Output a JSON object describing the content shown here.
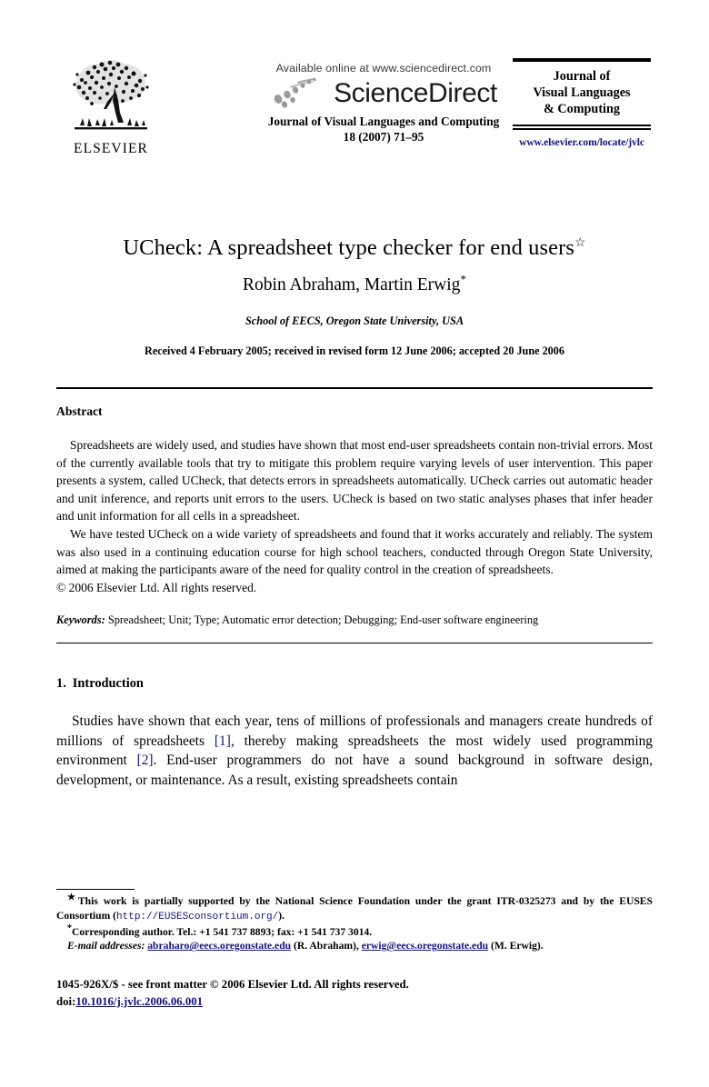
{
  "masthead": {
    "publisher_logo_name": "elsevier-tree-logo",
    "publisher_wordmark": "ELSEVIER",
    "available_online": "Available online at www.sciencedirect.com",
    "sciencedirect_wordmark": "ScienceDirect",
    "journal_name_line": "Journal of Visual Languages and Computing",
    "volume_line": "18 (2007) 71–95",
    "journal_box_title_line1": "Journal of",
    "journal_box_title_line2": "Visual Languages",
    "journal_box_title_line3": "& Computing",
    "journal_url": "www.elsevier.com/locate/jvlc",
    "link_color": "#14137a"
  },
  "title_block": {
    "title": "UCheck: A spreadsheet type checker for end users",
    "title_footnote_marker": "☆",
    "authors": "Robin Abraham, Martin Erwig",
    "author_footnote_marker": "*",
    "affiliation": "School of EECS, Oregon State University, USA",
    "received": "Received 4 February 2005; received in revised form 12 June 2006; accepted 20 June 2006"
  },
  "abstract": {
    "heading": "Abstract",
    "paragraph_1": "Spreadsheets are widely used, and studies have shown that most end-user spreadsheets contain non-trivial errors. Most of the currently available tools that try to mitigate this problem require varying levels of user intervention. This paper presents a system, called UCheck, that detects errors in spreadsheets automatically. UCheck carries out automatic header and unit inference, and reports unit errors to the users. UCheck is based on two static analyses phases that infer header and unit information for all cells in a spreadsheet.",
    "paragraph_2": "We have tested UCheck on a wide variety of spreadsheets and found that it works accurately and reliably. The system was also used in a continuing education course for high school teachers, conducted through Oregon State University, aimed at making the participants aware of the need for quality control in the creation of spreadsheets.",
    "copyright": "© 2006 Elsevier Ltd. All rights reserved.",
    "keywords_label": "Keywords:",
    "keywords_value": "Spreadsheet; Unit; Type; Automatic error detection; Debugging; End-user software engineering"
  },
  "introduction": {
    "section_number": "1.",
    "section_title": "Introduction",
    "paragraph_part_1": "Studies have shown that each year, tens of millions of professionals and managers create hundreds of millions of spreadsheets ",
    "citation_1": "[1]",
    "paragraph_part_2": ", thereby making spreadsheets the most widely used programming environment ",
    "citation_2": "[2]",
    "paragraph_part_3": ". End-user programmers do not have a sound background in software design, development, or maintenance. As a result, existing spreadsheets contain"
  },
  "footnotes": {
    "star_marker": "★",
    "funding_part_1": "This work is partially supported by the National Science Foundation under the grant ITR-0325273 and by the EUSES Consortium (",
    "funding_url": "http://EUSESconsortium.org/",
    "funding_part_2": ").",
    "corresponding_marker": "*",
    "corresponding_text": "Corresponding author. Tel.: +1 541 737 8893; fax: +1 541 737 3014.",
    "email_label": "E-mail addresses:",
    "email_1": "abraharo@eecs.oregonstate.edu",
    "email_1_owner": "(R. Abraham),",
    "email_2": "erwig@eecs.oregonstate.edu",
    "email_2_owner": "(M. Erwig)."
  },
  "bottom_matter": {
    "issn_line": "1045-926X/$ - see front matter © 2006 Elsevier Ltd. All rights reserved.",
    "doi_label": "doi:",
    "doi_value": "10.1016/j.jvlc.2006.06.001"
  }
}
